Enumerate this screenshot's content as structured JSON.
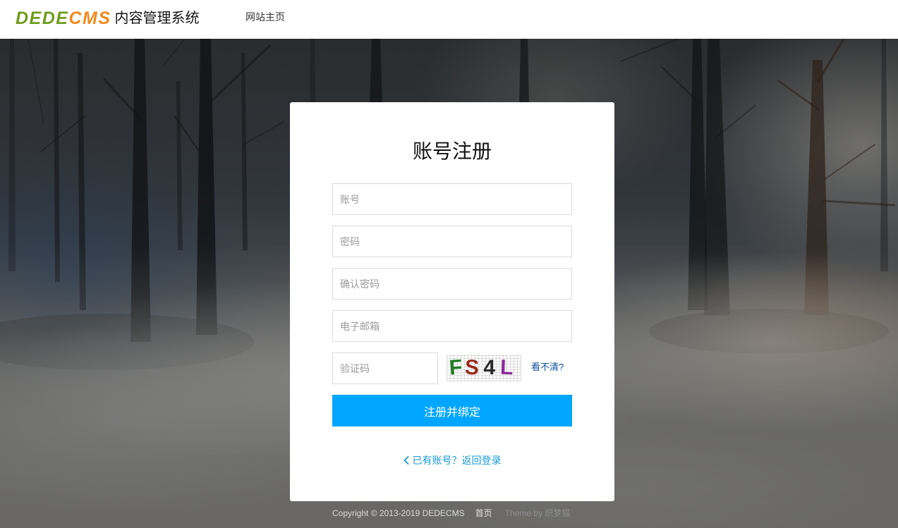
{
  "header": {
    "logo": {
      "part1": "DEDE",
      "part2": "CMS",
      "subtitle": "内容管理系统"
    },
    "nav": [
      {
        "label": "网站主页"
      }
    ]
  },
  "register": {
    "title": "账号注册",
    "fields": {
      "username": {
        "placeholder": "账号",
        "value": ""
      },
      "password": {
        "placeholder": "密码",
        "value": ""
      },
      "confirm_password": {
        "placeholder": "确认密码",
        "value": ""
      },
      "email": {
        "placeholder": "电子邮箱",
        "value": ""
      },
      "captcha": {
        "placeholder": "验证码",
        "value": ""
      }
    },
    "captcha_image": {
      "chars": [
        "F",
        "S",
        "4",
        "L"
      ],
      "char_colors": [
        "#1f7a25",
        "#9a2a1e",
        "#2a2a2a",
        "#8b2a9c"
      ]
    },
    "captcha_refresh_label": "看不清?",
    "submit_label": "注册并绑定",
    "login_link": {
      "icon": "chevron-left-icon",
      "label": "已有账号？返回登录"
    }
  },
  "footer": {
    "copyright": "Copyright © 2013-2019 DEDECMS",
    "home_link": "首页",
    "theme_credit": "Theme by 织梦猫"
  },
  "colors": {
    "accent": "#00a6ff",
    "login_link": "#1a9ad6",
    "refresh_link": "#0d4fa0",
    "logo_green": "#6f9c1d",
    "logo_orange": "#f08a1c"
  }
}
